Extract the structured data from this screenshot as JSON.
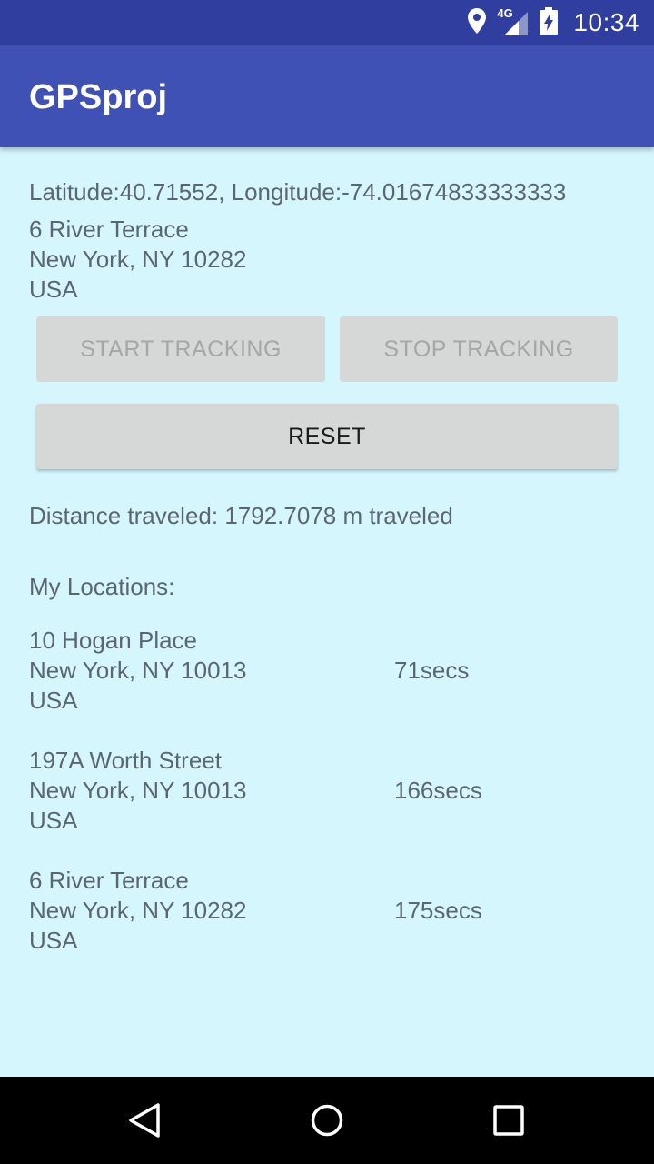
{
  "status_bar": {
    "time": "10:34",
    "network": "4G",
    "icons": [
      "location-icon",
      "signal-icon",
      "battery-charging-icon"
    ]
  },
  "app_bar": {
    "title": "GPSproj"
  },
  "current": {
    "coordinates": "Latitude:40.71552, Longitude:-74.01674833333333",
    "address": [
      "6 River Terrace",
      "New York, NY 10282",
      "USA"
    ]
  },
  "buttons": {
    "start": "START TRACKING",
    "stop": "STOP TRACKING",
    "reset": "RESET"
  },
  "distance_text": "Distance traveled: 1792.7078 m traveled",
  "locations_label": "My Locations:",
  "locations": [
    {
      "address": [
        "10 Hogan Place",
        "New York, NY 10013",
        "USA"
      ],
      "duration": "71secs"
    },
    {
      "address": [
        "197A Worth Street",
        "New York, NY 10013",
        "USA"
      ],
      "duration": "166secs"
    },
    {
      "address": [
        "6 River Terrace",
        "New York, NY 10282",
        "USA"
      ],
      "duration": "175secs"
    }
  ],
  "colors": {
    "status_bar": "#303f9f",
    "app_bar": "#3f51b5",
    "background": "#d6f6fe",
    "button": "#d6d7d7",
    "text": "#5b6770"
  },
  "nav_bar": {
    "icons": [
      "back-icon",
      "home-icon",
      "recents-icon"
    ]
  }
}
